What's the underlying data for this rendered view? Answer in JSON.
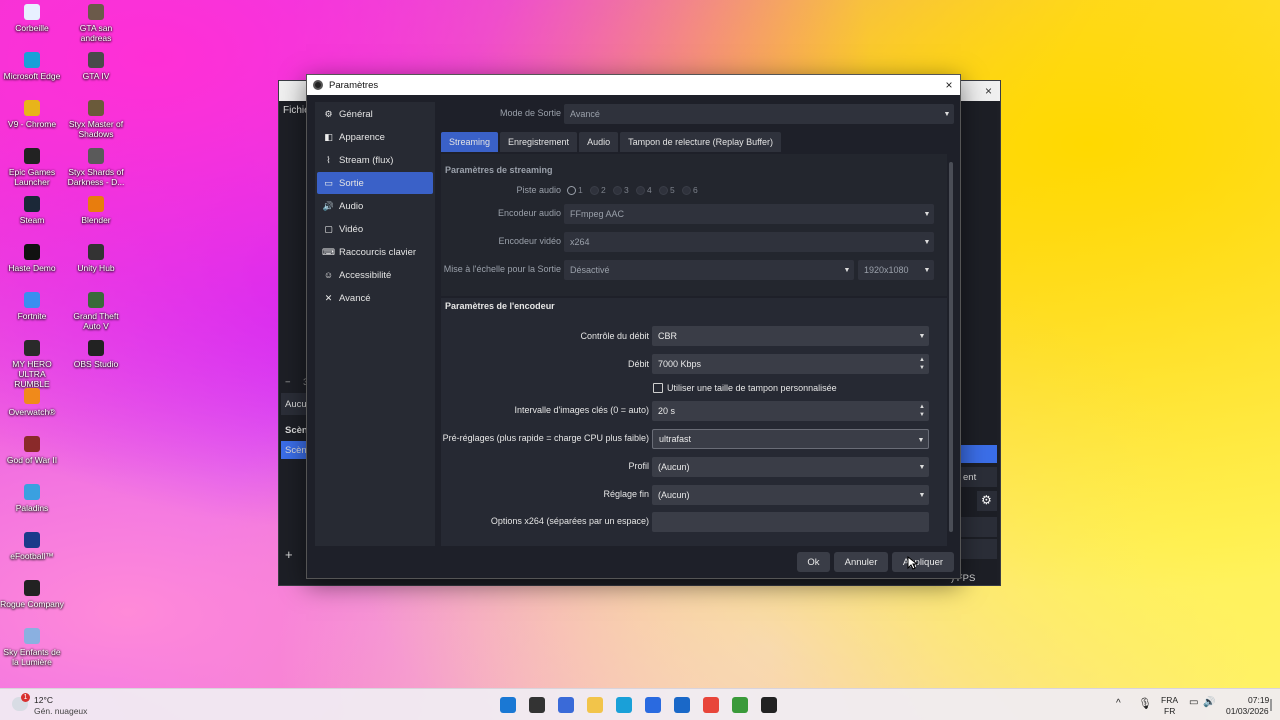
{
  "desktop": {
    "icons": [
      {
        "label": "Corbeille",
        "color": "#e8f0ff"
      },
      {
        "label": "GTA san andreas",
        "color": "#6b5a4a"
      },
      {
        "label": "Microsoft Edge",
        "color": "#1aa0d8"
      },
      {
        "label": "GTA IV",
        "color": "#4a4a4a"
      },
      {
        "label": "V9 - Chrome",
        "color": "#e8b41a"
      },
      {
        "label": "Styx Master of Shadows",
        "color": "#6a5a3a"
      },
      {
        "label": "Epic Games Launcher",
        "color": "#222222"
      },
      {
        "label": "Styx Shards of Darkness - D...",
        "color": "#5a5a5a"
      },
      {
        "label": "Steam",
        "color": "#1b2838"
      },
      {
        "label": "Blender",
        "color": "#e87d0d"
      },
      {
        "label": "Haste Demo",
        "color": "#111111"
      },
      {
        "label": "Unity Hub",
        "color": "#333333"
      },
      {
        "label": "Fortnite",
        "color": "#3a8ef0"
      },
      {
        "label": "Grand Theft Auto V",
        "color": "#3a6a3a"
      },
      {
        "label": "MY HERO ULTRA RUMBLE",
        "color": "#2a2a2a"
      },
      {
        "label": "OBS Studio",
        "color": "#222222"
      },
      {
        "label": "Overwatch®",
        "color": "#f08a1a"
      },
      {
        "label": "God of War II",
        "color": "#8a2a2a"
      },
      {
        "label": "Paladins",
        "color": "#3aa0e0"
      },
      {
        "label": "eFootball™",
        "color": "#1a3a8a"
      },
      {
        "label": "Rogue Company",
        "color": "#222222"
      },
      {
        "label": "Sky Enfants de la Lumière",
        "color": "#8ab0e0"
      }
    ]
  },
  "obs_background": {
    "menu_text": "Fichie",
    "label_aucun": "Aucu",
    "label_scenes": "Scène",
    "label_scene_item": "Scène",
    "minus_label": "−",
    "plus_label": "+",
    "side_ent": "ent",
    "fps_text": ") FPS",
    "num_3": "3"
  },
  "dialog": {
    "title": "Paramètres",
    "close": "×",
    "nav": [
      {
        "label": "Général",
        "icon": "gear-icon",
        "glyph": "⚙",
        "active": false
      },
      {
        "label": "Apparence",
        "icon": "palette-icon",
        "glyph": "◧",
        "active": false
      },
      {
        "label": "Stream (flux)",
        "icon": "antenna-icon",
        "glyph": "⌇",
        "active": false
      },
      {
        "label": "Sortie",
        "icon": "output-icon",
        "glyph": "▭",
        "active": true
      },
      {
        "label": "Audio",
        "icon": "speaker-icon",
        "glyph": "🔊",
        "active": false
      },
      {
        "label": "Vidéo",
        "icon": "monitor-icon",
        "glyph": "▢",
        "active": false
      },
      {
        "label": "Raccourcis clavier",
        "icon": "keyboard-icon",
        "glyph": "⌨",
        "active": false
      },
      {
        "label": "Accessibilité",
        "icon": "accessibility-icon",
        "glyph": "☺",
        "active": false
      },
      {
        "label": "Avancé",
        "icon": "tools-icon",
        "glyph": "✕",
        "active": false
      }
    ],
    "output_mode_label": "Mode de Sortie",
    "output_mode_value": "Avancé",
    "tabs": [
      "Streaming",
      "Enregistrement",
      "Audio",
      "Tampon de relecture (Replay Buffer)"
    ],
    "streaming_group_title": "Paramètres de streaming",
    "audio_track_label": "Piste audio",
    "audio_tracks": [
      "1",
      "2",
      "3",
      "4",
      "5",
      "6"
    ],
    "audio_encoder_label": "Encodeur audio",
    "audio_encoder_value": "FFmpeg AAC",
    "video_encoder_label": "Encodeur vidéo",
    "video_encoder_value": "x264",
    "rescale_label": "Mise à l'échelle pour la Sortie",
    "rescale_value": "Désactivé",
    "rescale_resolution": "1920x1080",
    "encoder_group_title": "Paramètres de l'encodeur",
    "rate_control_label": "Contrôle du débit",
    "rate_control_value": "CBR",
    "bitrate_label": "Débit",
    "bitrate_value": "7000 Kbps",
    "custom_buffer_label": "Utiliser une taille de tampon personnalisée",
    "keyframe_label": "Intervalle d'images clés (0 = auto)",
    "keyframe_value": "20 s",
    "preset_label": "Pré-réglages (plus rapide = charge CPU plus faible)",
    "preset_value": "ultrafast",
    "profile_label": "Profil",
    "profile_value": "(Aucun)",
    "tune_label": "Réglage fin",
    "tune_value": "(Aucun)",
    "x264_options_label": "Options x264 (séparées par un espace)",
    "x264_options_value": "",
    "buttons": {
      "ok": "Ok",
      "cancel": "Annuler",
      "apply": "Appliquer"
    }
  },
  "taskbar": {
    "weather_temp": "12°C",
    "weather_desc": "Gén. nuageux",
    "weather_badge": "1",
    "lang_top": "FRA",
    "lang_bottom": "FR",
    "time": "07:19",
    "date": "01/03/2026",
    "pinned": [
      {
        "name": "windows-start-icon",
        "color": "#1a78d4"
      },
      {
        "name": "search-icon",
        "color": "#333333"
      },
      {
        "name": "widgets-icon",
        "color": "#3a6ad8"
      },
      {
        "name": "file-explorer-icon",
        "color": "#f2c44a"
      },
      {
        "name": "edge-icon",
        "color": "#1aa0d8"
      },
      {
        "name": "store-icon",
        "color": "#2a6ae0"
      },
      {
        "name": "outlook-icon",
        "color": "#1a68c8"
      },
      {
        "name": "chrome-icon",
        "color": "#e8453a"
      },
      {
        "name": "vegas-icon",
        "color": "#3a9a3a"
      },
      {
        "name": "obs-icon",
        "color": "#222222"
      }
    ]
  }
}
